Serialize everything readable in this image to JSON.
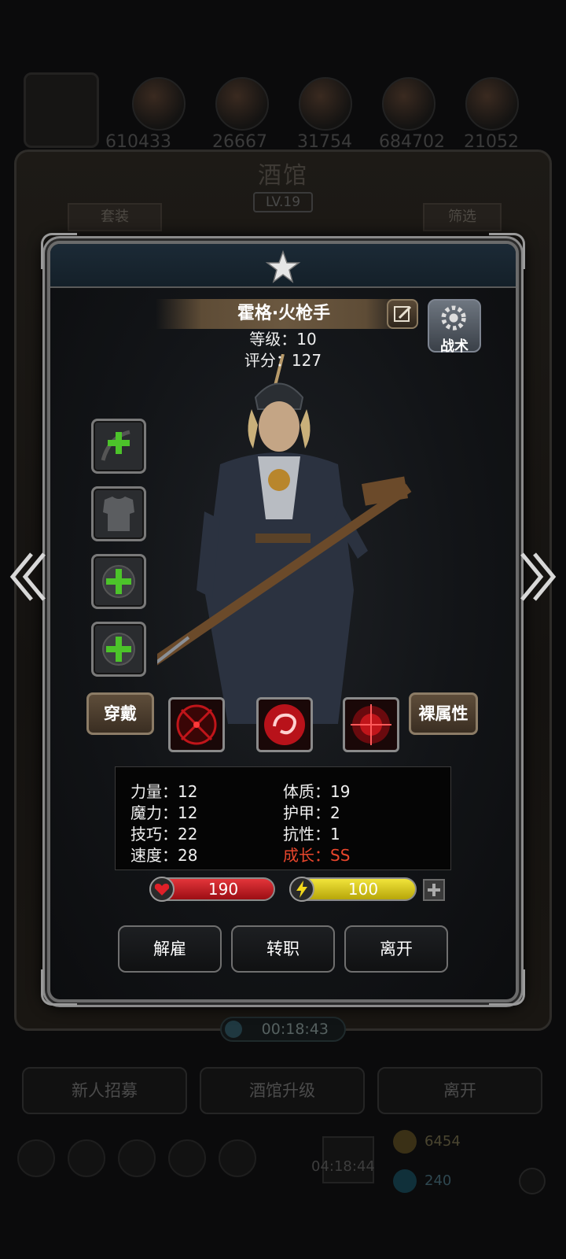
{
  "background": {
    "resources": [
      "610433",
      "26667",
      "31754",
      "684702",
      "21052"
    ],
    "title": "酒馆",
    "level": "LV.19",
    "left_tab": "套装",
    "right_tab": "筛选",
    "timer": "00:18:43",
    "buttons": [
      "新人招募",
      "酒馆升级",
      "离开"
    ],
    "bottom_timer": "04:18:44",
    "gold": "6454",
    "gems": "240"
  },
  "hero": {
    "name": "霍格·火枪手",
    "level_text": "等级：10",
    "score_text": "评分：127",
    "tactics_label": "战术"
  },
  "equipment": {
    "wear_label": "穿戴",
    "raw_attr_label": "裸属性"
  },
  "stats": {
    "strength": "力量：12",
    "magic": "魔力：12",
    "skill": "技巧：22",
    "speed": "速度：28",
    "constitution": "体质：19",
    "armor": "护甲：2",
    "resistance": "抗性：1",
    "growth": "成长：SS"
  },
  "vitals": {
    "hp": "190",
    "energy": "100"
  },
  "actions": {
    "dismiss": "解雇",
    "transfer": "转职",
    "leave": "离开"
  },
  "colors": {
    "hp_bar": "#c8141a",
    "energy_bar": "#d4c40e",
    "growth_text": "#e8462c",
    "panel_bg": "#121417"
  }
}
